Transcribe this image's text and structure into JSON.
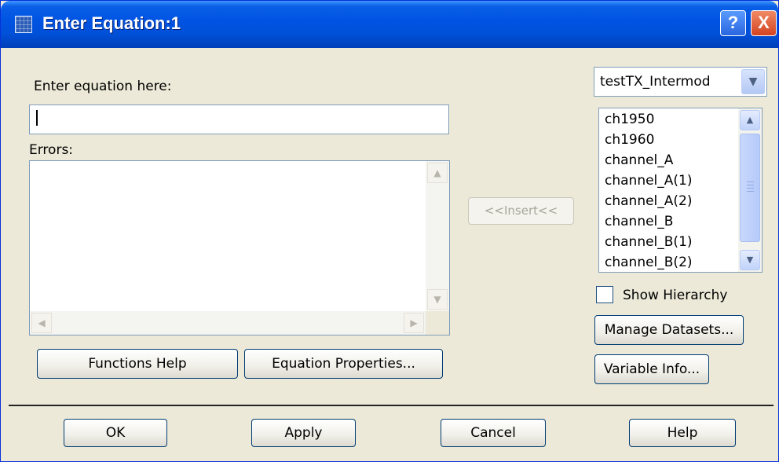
{
  "window": {
    "title": "Enter Equation:1"
  },
  "titlebar_buttons": {
    "help": "?",
    "close": "X"
  },
  "equation": {
    "label": "Enter equation here:",
    "value": ""
  },
  "errors": {
    "label": "Errors:"
  },
  "insert_button": "<<Insert<<",
  "dataset": {
    "selected": "testTX_Intermod",
    "variables": [
      "ch1950",
      "ch1960",
      "channel_A",
      "channel_A(1)",
      "channel_A(2)",
      "channel_B",
      "channel_B(1)",
      "channel_B(2)"
    ]
  },
  "show_hierarchy": {
    "label": "Show Hierarchy",
    "checked": false
  },
  "buttons": {
    "manage_datasets": "Manage Datasets...",
    "variable_info": "Variable Info...",
    "functions_help": "Functions Help",
    "equation_properties": "Equation Properties...",
    "ok": "OK",
    "apply": "Apply",
    "cancel": "Cancel",
    "help": "Help"
  }
}
